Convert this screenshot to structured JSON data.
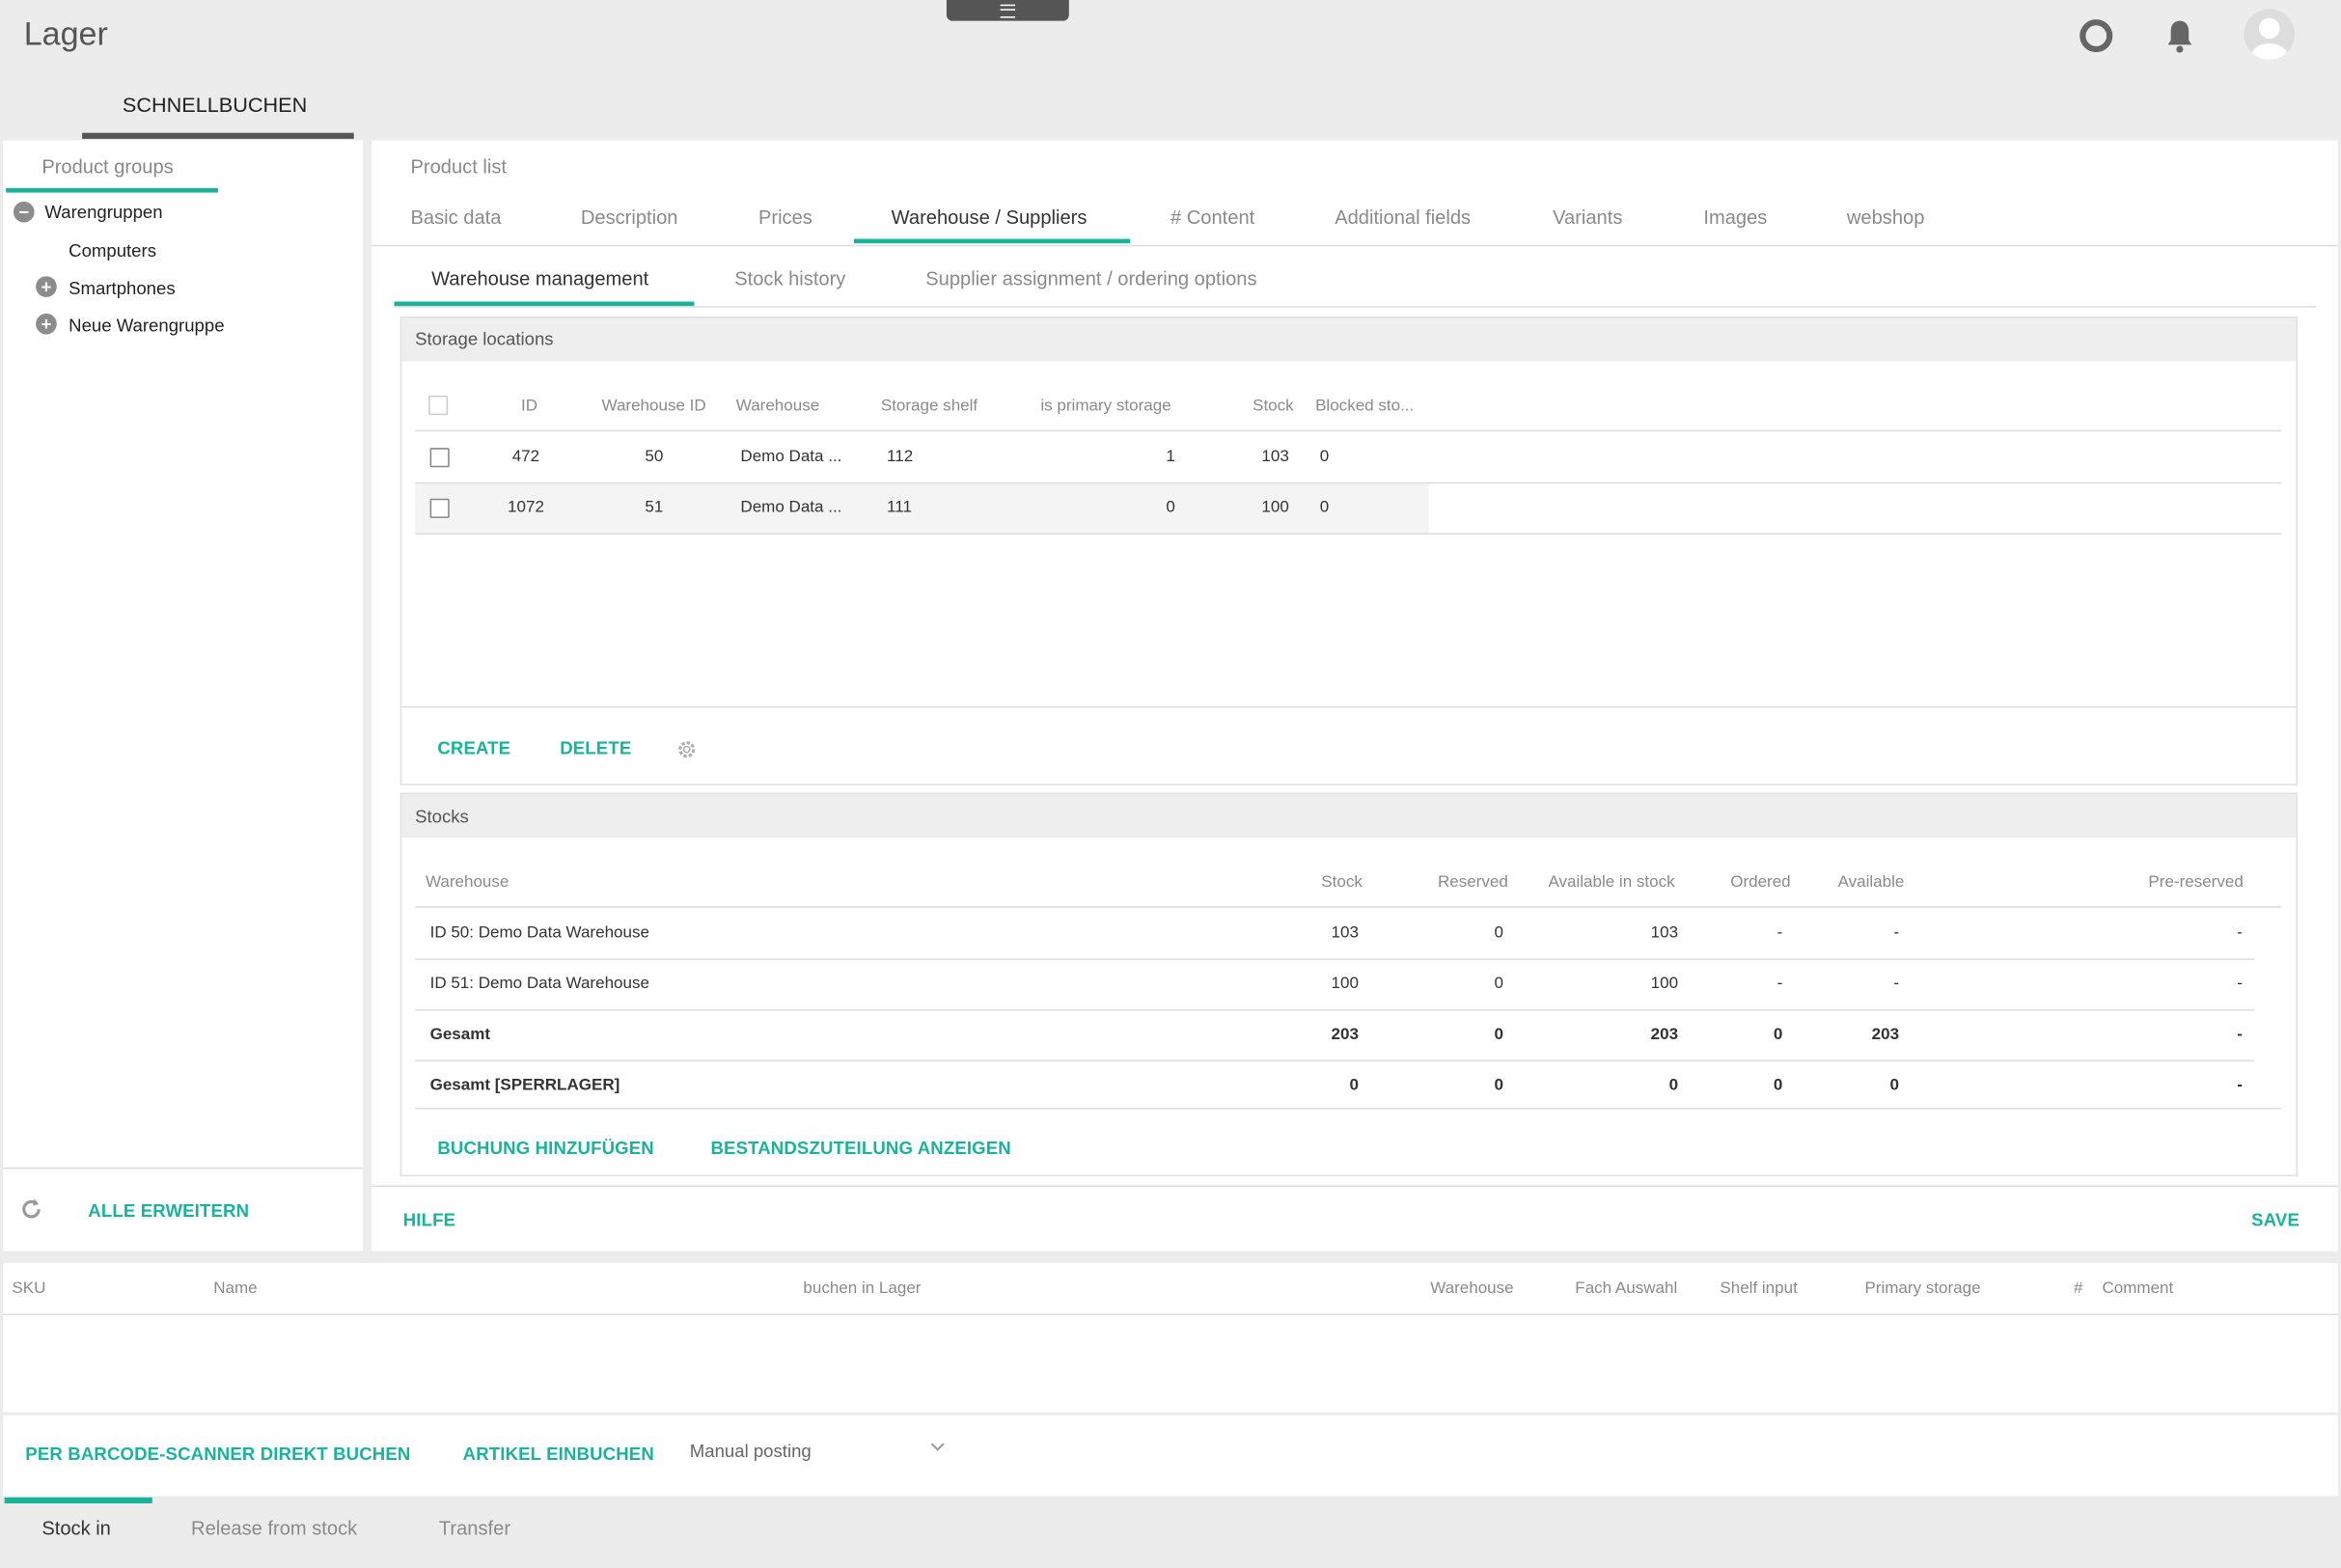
{
  "app": {
    "title": "Lager"
  },
  "header": {
    "menu_icon": "hamburger-icon",
    "tab_quick_booking": "SCHNELLBUCHEN"
  },
  "sidebar": {
    "title": "Product groups",
    "tree": [
      {
        "label": "Warengruppen",
        "state": "expanded"
      },
      {
        "label": "Computers",
        "state": "leaf"
      },
      {
        "label": "Smartphones",
        "state": "collapsed"
      },
      {
        "label": "Neue Warengruppe",
        "state": "collapsed"
      }
    ],
    "expand_all": "ALLE ERWEITERN"
  },
  "main": {
    "product_list_label": "Product list",
    "tabs": [
      "Basic data",
      "Description",
      "Prices",
      "Warehouse / Suppliers",
      "# Content",
      "Additional fields",
      "Variants",
      "Images",
      "webshop"
    ],
    "active_tab": "Warehouse / Suppliers",
    "subtabs": [
      "Warehouse management",
      "Stock history",
      "Supplier assignment / ordering options"
    ],
    "active_subtab": "Warehouse management",
    "storage": {
      "title": "Storage locations",
      "headers": [
        "ID",
        "Warehouse ID",
        "Warehouse",
        "Storage shelf",
        "is primary storage",
        "Stock",
        "Blocked sto..."
      ],
      "rows": [
        [
          "472",
          "50",
          "Demo Data ...",
          "112",
          "1",
          "103",
          "0"
        ],
        [
          "1072",
          "51",
          "Demo Data ...",
          "111",
          "0",
          "100",
          "0"
        ]
      ],
      "create": "CREATE",
      "delete": "DELETE"
    },
    "stocks": {
      "title": "Stocks",
      "headers": [
        "Warehouse",
        "Stock",
        "Reserved",
        "Available in stock",
        "Ordered",
        "Available",
        "Pre-reserved"
      ],
      "rows": [
        [
          "ID 50: Demo Data Warehouse",
          "103",
          "0",
          "103",
          "-",
          "-",
          "-"
        ],
        [
          "ID 51: Demo Data Warehouse",
          "100",
          "0",
          "100",
          "-",
          "-",
          "-"
        ],
        [
          "Gesamt",
          "203",
          "0",
          "203",
          "0",
          "203",
          "-"
        ],
        [
          "Gesamt [SPERRLAGER]",
          "0",
          "0",
          "0",
          "0",
          "0",
          "-"
        ]
      ],
      "add_booking": "BUCHUNG HINZUFÜGEN",
      "show_allocation": "BESTANDSZUTEILUNG ANZEIGEN"
    },
    "help": "HILFE",
    "save": "SAVE"
  },
  "booking": {
    "headers": [
      "SKU",
      "Name",
      "buchen in Lager",
      "Warehouse",
      "Fach Auswahl",
      "Shelf input",
      "Primary storage",
      "#",
      "Comment"
    ],
    "scanner": "PER BARCODE-SCANNER DIREKT BUCHEN",
    "article_book": "ARTIKEL EINBUCHEN",
    "mode": "Manual posting",
    "bottom_tabs": [
      "Stock in",
      "Release from stock",
      "Transfer"
    ],
    "active_bottom_tab": "Stock in"
  },
  "colors": {
    "accent": "#19b39b",
    "header_bg": "#ececec",
    "panel_bg": "#ffffff"
  }
}
